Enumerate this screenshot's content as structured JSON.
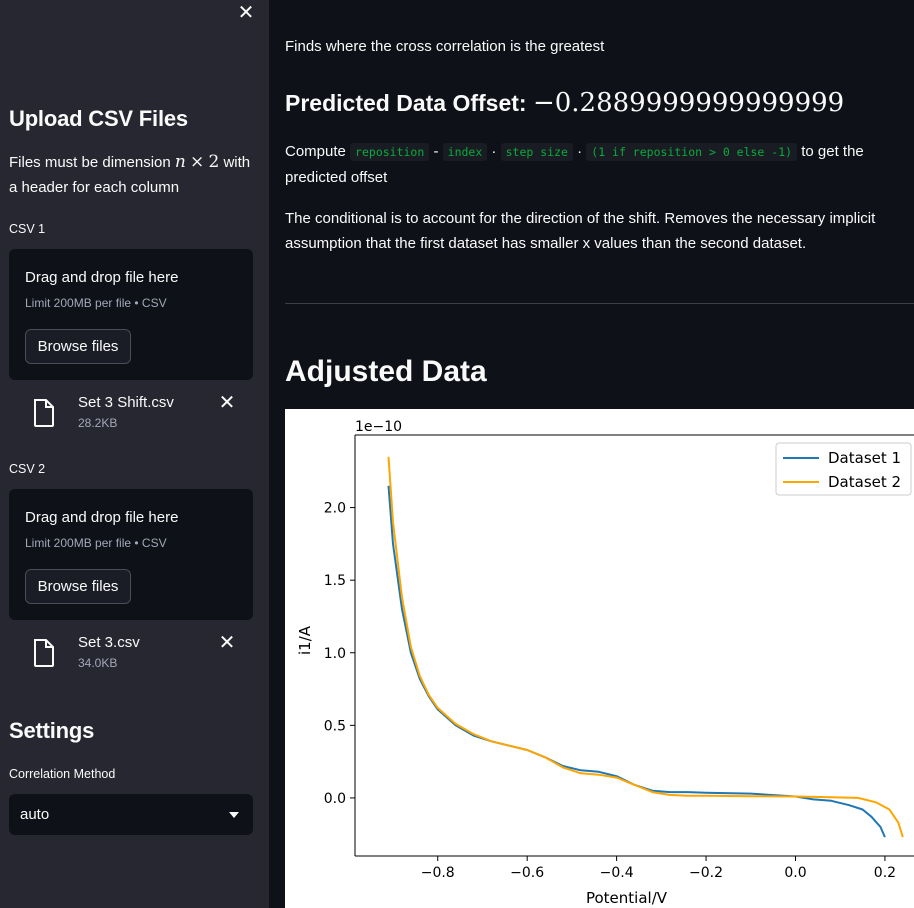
{
  "sidebar": {
    "close_glyph": "✕",
    "upload_title": "Upload CSV Files",
    "desc_pre": "Files must be dimension ",
    "desc_math_n": "n",
    "desc_math_times": "×",
    "desc_math_2": "2",
    "desc_post": " with a header for each column",
    "csv1_label": "CSV 1",
    "csv2_label": "CSV 2",
    "dropzone_title": "Drag and drop file here",
    "dropzone_limit": "Limit 200MB per file • CSV",
    "browse_label": "Browse files",
    "file1": {
      "name": "Set 3 Shift.csv",
      "size": "28.2KB"
    },
    "file2": {
      "name": "Set 3.csv",
      "size": "34.0KB"
    },
    "remove_glyph": "✕",
    "settings_title": "Settings",
    "corr_label": "Correlation Method",
    "corr_value": "auto"
  },
  "main": {
    "intro": "Finds where the cross correlation is the greatest",
    "offset_label": "Predicted Data Offset: ",
    "offset_value": "−0.2889999999999999",
    "compute_pre": "Compute ",
    "code1": "reposition",
    "op1": " - ",
    "code2": "index",
    "op2": " · ",
    "code3": "step size",
    "op3": " · ",
    "code4": "(1 if reposition > 0 else -1)",
    "compute_post": " to get the predicted offset",
    "conditional_note": "The conditional is to account for the direction of the shift. Removes the necessary implicit assumption that the first dataset has smaller x values than the second dataset.",
    "adjusted_title": "Adjusted Data"
  },
  "chart_data": {
    "type": "line",
    "xlabel": "Potential/V",
    "ylabel": "i1/A",
    "y_scale_label": "1e−10",
    "xlim": [
      -0.985,
      0.265
    ],
    "ylim": [
      -0.4,
      2.5
    ],
    "x_ticks": [
      -0.8,
      -0.6,
      -0.4,
      -0.2,
      0.0,
      0.2
    ],
    "x_tick_labels": [
      "−0.8",
      "−0.6",
      "−0.4",
      "−0.2",
      "0.0",
      "0.2"
    ],
    "y_ticks": [
      0.0,
      0.5,
      1.0,
      1.5,
      2.0
    ],
    "y_tick_labels": [
      "0.0",
      "0.5",
      "1.0",
      "1.5",
      "2.0"
    ],
    "legend_position": "upper-right",
    "series": [
      {
        "name": "Dataset 1",
        "color": "#1f77b4",
        "x": [
          -0.91,
          -0.9,
          -0.88,
          -0.86,
          -0.84,
          -0.82,
          -0.8,
          -0.76,
          -0.72,
          -0.68,
          -0.64,
          -0.6,
          -0.56,
          -0.52,
          -0.48,
          -0.44,
          -0.4,
          -0.36,
          -0.32,
          -0.28,
          -0.24,
          -0.2,
          -0.1,
          0.0,
          0.04,
          0.08,
          0.12,
          0.15,
          0.17,
          0.19,
          0.2
        ],
        "y": [
          2.15,
          1.75,
          1.3,
          1.0,
          0.82,
          0.7,
          0.61,
          0.5,
          0.43,
          0.39,
          0.36,
          0.33,
          0.28,
          0.22,
          0.19,
          0.18,
          0.15,
          0.09,
          0.05,
          0.04,
          0.04,
          0.035,
          0.03,
          0.01,
          -0.01,
          -0.02,
          -0.05,
          -0.08,
          -0.13,
          -0.2,
          -0.27
        ]
      },
      {
        "name": "Dataset 2",
        "color": "#ffa500",
        "x": [
          -0.91,
          -0.9,
          -0.88,
          -0.86,
          -0.84,
          -0.82,
          -0.8,
          -0.76,
          -0.72,
          -0.68,
          -0.64,
          -0.6,
          -0.56,
          -0.52,
          -0.48,
          -0.44,
          -0.4,
          -0.36,
          -0.32,
          -0.28,
          -0.24,
          -0.2,
          -0.1,
          0.0,
          0.08,
          0.14,
          0.18,
          0.21,
          0.23,
          0.24
        ],
        "y": [
          2.35,
          1.9,
          1.38,
          1.04,
          0.84,
          0.71,
          0.62,
          0.51,
          0.44,
          0.39,
          0.36,
          0.33,
          0.28,
          0.21,
          0.17,
          0.16,
          0.14,
          0.09,
          0.04,
          0.02,
          0.015,
          0.015,
          0.012,
          0.01,
          0.005,
          0.0,
          -0.03,
          -0.08,
          -0.17,
          -0.27
        ]
      }
    ]
  }
}
